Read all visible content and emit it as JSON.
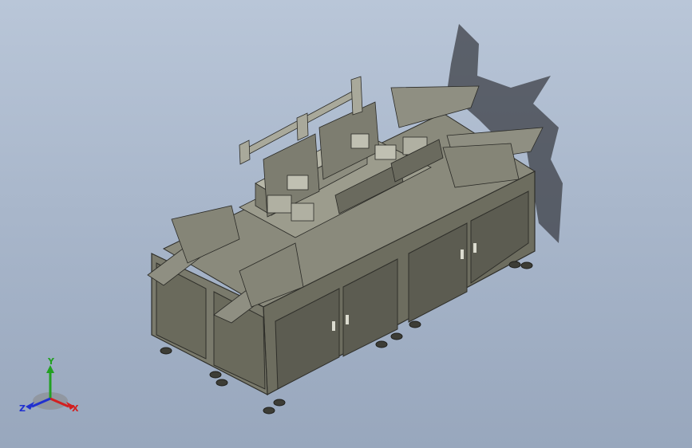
{
  "viewport": {
    "background_top": "#b9c6d8",
    "background_bottom": "#98a7bd",
    "model_body_color": "#6d6d5f",
    "model_panel_color": "#5c5c51",
    "model_edge_color": "#2f2f2a",
    "shadow_color": "#3c3f46"
  },
  "triad": {
    "x_label": "X",
    "y_label": "Y",
    "z_label": "Z",
    "x_color": "#d22020",
    "y_color": "#22a022",
    "z_color": "#2030d0"
  }
}
